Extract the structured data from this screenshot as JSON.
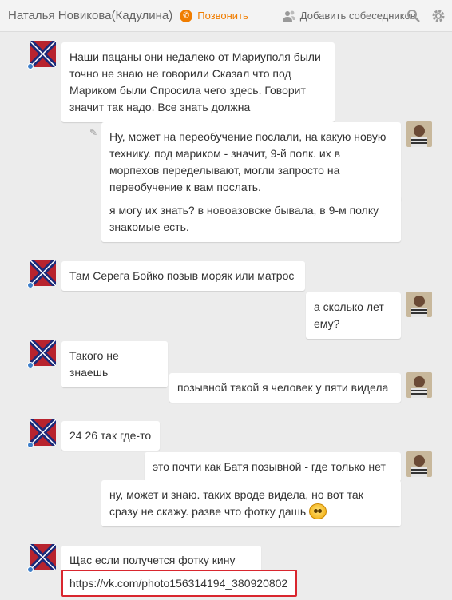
{
  "header": {
    "contact_name": "Наталья Новикова(Кадулина)",
    "call_label": "Позвонить",
    "add_participants_label": "Добавить собеседников"
  },
  "colors": {
    "accent": "#f07d00",
    "highlight_border": "#d9262e",
    "online": "#3c7ec9"
  },
  "messages": [
    {
      "side": "left",
      "text": "Наши пацаны они недалеко от Мариуполя были точно не знаю не говорили    Сказал что под Мариком были   Спросила чего здесь.   Говорит значит так надо. Все знать должна"
    },
    {
      "side": "right",
      "text": "Ну, может на переобучение послали, на какую новую технику. под мариком - значит, 9-й полк. их в морпехов переделывают, могли запросто на переобучение к вам послать."
    },
    {
      "side": "right",
      "text": "я могу их знать? в новоазовске бывала, в 9-м полку знакомые есть."
    },
    {
      "side": "left",
      "text": "Там Серега Бойко позыв моряк или матрос"
    },
    {
      "side": "right",
      "text": "а сколько лет ему?"
    },
    {
      "side": "left",
      "text": "Такого не знаешь"
    },
    {
      "side": "right",
      "text": "позывной такой я человек у пяти видела"
    },
    {
      "side": "left",
      "text": "24 26 так где-то"
    },
    {
      "side": "right",
      "text": "это почти как Батя позывной - где только нет"
    },
    {
      "side": "right",
      "text": "ну, может и знаю. таких вроде видела, но вот так сразу не скажу. разве что фотку дашь"
    },
    {
      "side": "left",
      "text": "Щас если получется фотку кину"
    },
    {
      "side": "left",
      "text": "https://vk.com/photo156314194_380920802"
    }
  ]
}
